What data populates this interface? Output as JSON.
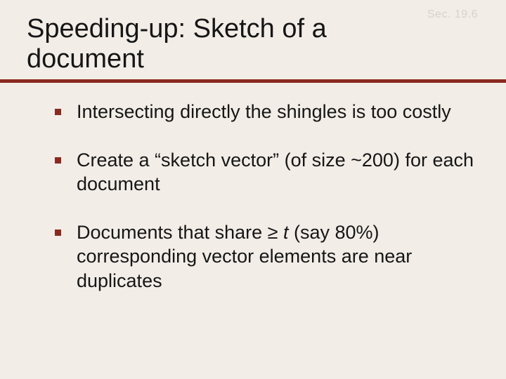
{
  "section_label": "Sec. 19.6",
  "title": "Speeding-up: Sketch of a document",
  "bullets": [
    {
      "text": "Intersecting directly the shingles is too costly"
    },
    {
      "text": "Create a “sketch vector” (of size ~200) for each document"
    },
    {
      "text_html": "Documents that share ≥ <span class=\"ital\">t</span> (say 80%) corresponding vector elements are near duplicates"
    }
  ],
  "colors": {
    "background": "#f2ede7",
    "accent": "#8a2a1f",
    "faded": "#d8d2cb"
  }
}
